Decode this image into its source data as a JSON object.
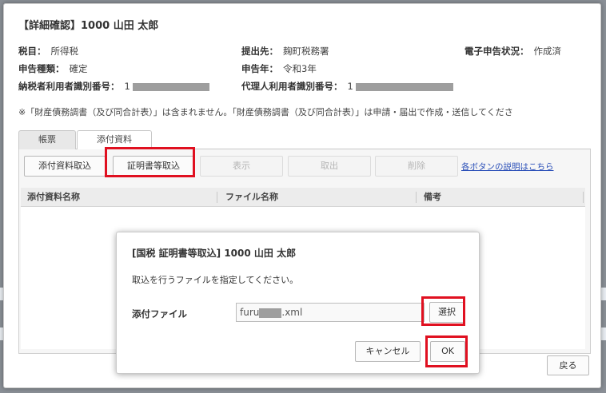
{
  "dialog": {
    "title": "【詳細確認】1000 山田 太郎",
    "fields": {
      "tax_type_label": "税目：",
      "tax_type_value": "所得税",
      "submit_to_label": "提出先：",
      "submit_to_value": "麹町税務署",
      "efiling_status_label": "電子申告状況：",
      "efiling_status_value": "作成済",
      "filing_type_label": "申告種類：",
      "filing_type_value": "確定",
      "filing_year_label": "申告年：",
      "filing_year_value": "令和3年",
      "taxpayer_id_label": "納税者利用者識別番号：",
      "taxpayer_id_value": "1",
      "agent_id_label": "代理人利用者識別番号：",
      "agent_id_value": "1"
    },
    "notice": "※「財産債務調書（及び同合計表）」は含まれません。「財産債務調書（及び同合計表）」は申請・届出で作成・送信してくださ",
    "tabs": [
      "帳票",
      "添付資料"
    ],
    "toolbar": {
      "attach_import": "添付資料取込",
      "cert_import": "証明書等取込",
      "view": "表示",
      "export": "取出",
      "delete": "削除",
      "help_link": "各ボタンの説明はこちら"
    },
    "table_headers": [
      "添付資料名称",
      "ファイル名称",
      "備考"
    ],
    "back_button": "戻る"
  },
  "modal": {
    "title": "[国税 証明書等取込] 1000 山田 太郎",
    "message": "取込を行うファイルを指定してください。",
    "file_label": "添付ファイル",
    "file_value_prefix": "furu",
    "file_value_suffix": ".xml",
    "select_button": "選択",
    "cancel_button": "キャンセル",
    "ok_button": "OK"
  },
  "colors": {
    "highlight": "#e01020",
    "link": "#2a4fb8",
    "redaction": "#9e9e9e"
  }
}
